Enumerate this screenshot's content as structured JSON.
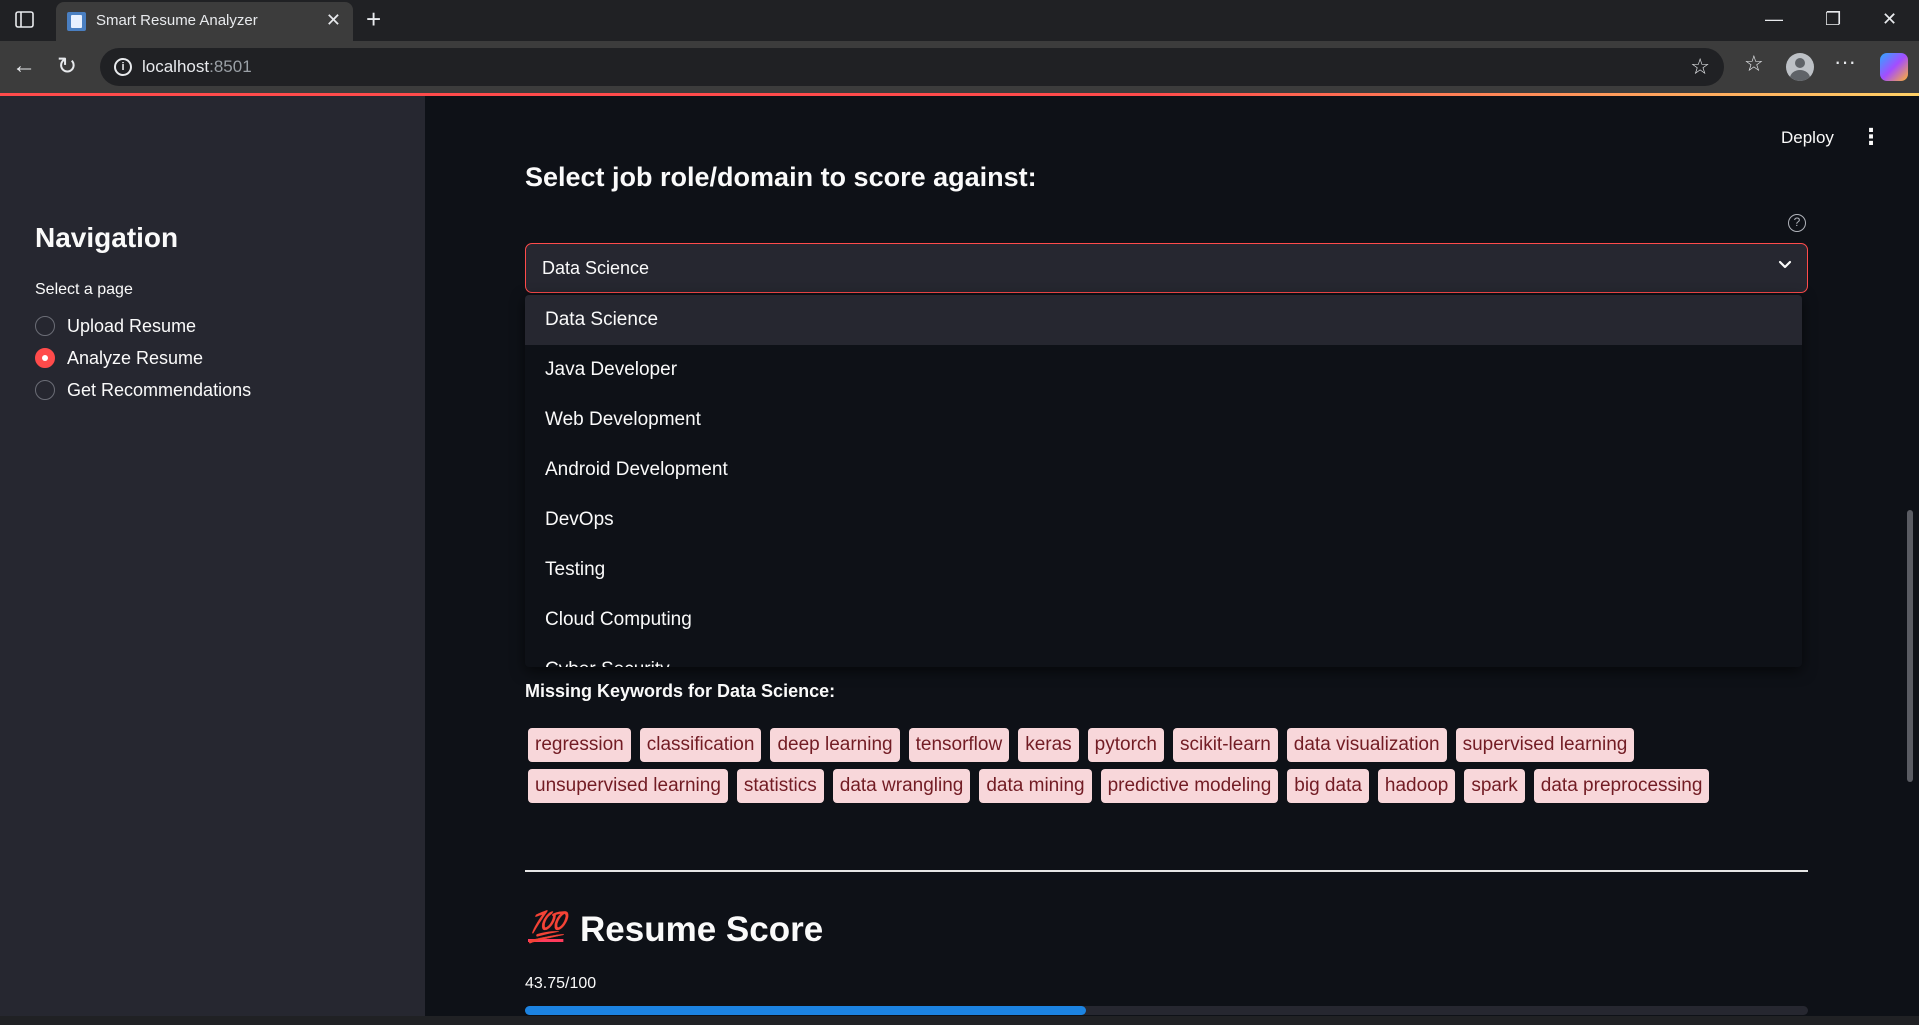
{
  "browser": {
    "tab_title": "Smart Resume Analyzer",
    "url_host": "localhost",
    "url_port": ":8501",
    "icons": [
      "sidebar-toggle-icon",
      "tab-favicon",
      "close-icon",
      "new-tab-icon",
      "minimize-icon",
      "restore-icon",
      "window-close-icon",
      "back-icon",
      "reload-icon",
      "info-icon",
      "star-icon",
      "favorites-icon",
      "profile-icon",
      "more-icon",
      "copilot-icon"
    ]
  },
  "app": {
    "deploy_label": "Deploy",
    "sidebar": {
      "title": "Navigation",
      "radio_label": "Select a page",
      "options": [
        "Upload Resume",
        "Analyze Resume",
        "Get Recommendations"
      ],
      "selected": "Analyze Resume"
    },
    "main": {
      "section_title": "Select job role/domain to score against:",
      "select": {
        "value": "Data Science",
        "options": [
          "Data Science",
          "Java Developer",
          "Web Development",
          "Android Development",
          "DevOps",
          "Testing",
          "Cloud Computing",
          "Cyber Security"
        ]
      },
      "missing_keywords_title": "Missing Keywords for Data Science:",
      "missing_keywords": [
        "regression",
        "classification",
        "deep learning",
        "tensorflow",
        "keras",
        "pytorch",
        "scikit-learn",
        "data visualization",
        "supervised learning",
        "unsupervised learning",
        "statistics",
        "data wrangling",
        "data mining",
        "predictive modeling",
        "big data",
        "hadoop",
        "spark",
        "data preprocessing"
      ],
      "score_emoji": "💯",
      "score_title": "Resume Score",
      "score_text": "43.75/100",
      "score_fraction": 0.4375
    },
    "colors": {
      "accent": "#ff4b4b",
      "progress": "#1c83e1",
      "chip_bg": "#f8d7da",
      "chip_text": "#721c24"
    }
  }
}
